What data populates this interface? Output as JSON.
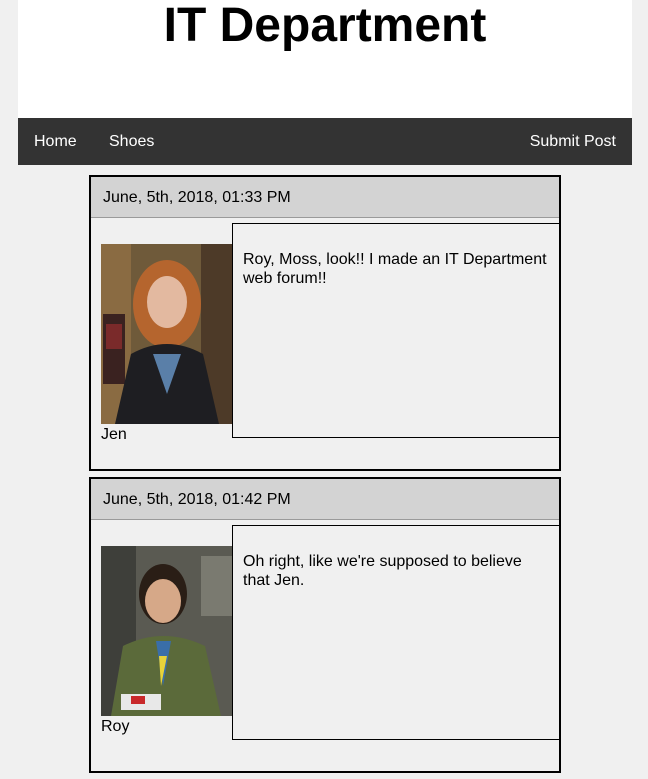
{
  "header": {
    "title": "IT Department"
  },
  "nav": {
    "home": "Home",
    "shoes": "Shoes",
    "submit_post": "Submit Post"
  },
  "posts": [
    {
      "date": "June, 5th, 2018, 01:33 PM",
      "author": "Jen",
      "body": "Roy, Moss, look!! I made an IT Department web forum!!"
    },
    {
      "date": "June, 5th, 2018, 01:42 PM",
      "author": "Roy",
      "body": "Oh right, like we're supposed to believe that Jen."
    }
  ]
}
